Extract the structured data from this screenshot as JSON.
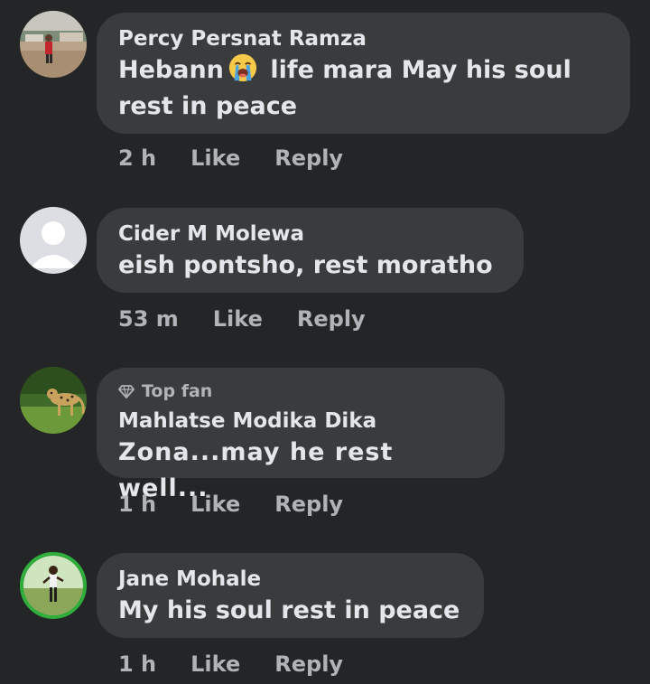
{
  "comments": [
    {
      "author": "Percy Persnat Ramza",
      "text_before_emoji": "Hebann",
      "emoji": "loudly-crying-face-icon",
      "text_after_emoji": "life mara May his soul rest in peace",
      "time": "2 h",
      "like": "Like",
      "reply": "Reply"
    },
    {
      "author": "Cider M Molewa",
      "text": "eish pontsho, rest moratho",
      "time": "53 m",
      "like": "Like",
      "reply": "Reply"
    },
    {
      "badge": "Top fan",
      "badge_icon": "diamond-icon",
      "author": "Mahlatse Modika Dika",
      "text": "Zona...may he rest well...",
      "time": "1 h",
      "like": "Like",
      "reply": "Reply"
    },
    {
      "author": "Jane Mohale",
      "text": "My his soul rest in peace",
      "time": "1 h",
      "like": "Like",
      "reply": "Reply"
    }
  ],
  "colors": {
    "background": "#242526",
    "bubble": "#3a3b3c",
    "primary_text": "#e4e6eb",
    "secondary_text": "#b0b3b8"
  }
}
